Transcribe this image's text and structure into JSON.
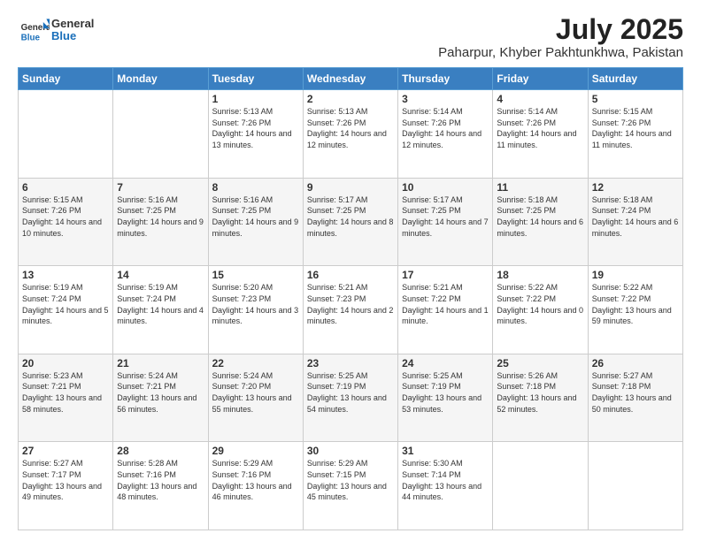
{
  "logo": {
    "general": "General",
    "blue": "Blue"
  },
  "title": "July 2025",
  "subtitle": "Paharpur, Khyber Pakhtunkhwa, Pakistan",
  "days": [
    "Sunday",
    "Monday",
    "Tuesday",
    "Wednesday",
    "Thursday",
    "Friday",
    "Saturday"
  ],
  "weeks": [
    [
      {
        "day": "",
        "info": ""
      },
      {
        "day": "",
        "info": ""
      },
      {
        "day": "1",
        "info": "Sunrise: 5:13 AM\nSunset: 7:26 PM\nDaylight: 14 hours and 13 minutes."
      },
      {
        "day": "2",
        "info": "Sunrise: 5:13 AM\nSunset: 7:26 PM\nDaylight: 14 hours and 12 minutes."
      },
      {
        "day": "3",
        "info": "Sunrise: 5:14 AM\nSunset: 7:26 PM\nDaylight: 14 hours and 12 minutes."
      },
      {
        "day": "4",
        "info": "Sunrise: 5:14 AM\nSunset: 7:26 PM\nDaylight: 14 hours and 11 minutes."
      },
      {
        "day": "5",
        "info": "Sunrise: 5:15 AM\nSunset: 7:26 PM\nDaylight: 14 hours and 11 minutes."
      }
    ],
    [
      {
        "day": "6",
        "info": "Sunrise: 5:15 AM\nSunset: 7:26 PM\nDaylight: 14 hours and 10 minutes."
      },
      {
        "day": "7",
        "info": "Sunrise: 5:16 AM\nSunset: 7:25 PM\nDaylight: 14 hours and 9 minutes."
      },
      {
        "day": "8",
        "info": "Sunrise: 5:16 AM\nSunset: 7:25 PM\nDaylight: 14 hours and 9 minutes."
      },
      {
        "day": "9",
        "info": "Sunrise: 5:17 AM\nSunset: 7:25 PM\nDaylight: 14 hours and 8 minutes."
      },
      {
        "day": "10",
        "info": "Sunrise: 5:17 AM\nSunset: 7:25 PM\nDaylight: 14 hours and 7 minutes."
      },
      {
        "day": "11",
        "info": "Sunrise: 5:18 AM\nSunset: 7:25 PM\nDaylight: 14 hours and 6 minutes."
      },
      {
        "day": "12",
        "info": "Sunrise: 5:18 AM\nSunset: 7:24 PM\nDaylight: 14 hours and 6 minutes."
      }
    ],
    [
      {
        "day": "13",
        "info": "Sunrise: 5:19 AM\nSunset: 7:24 PM\nDaylight: 14 hours and 5 minutes."
      },
      {
        "day": "14",
        "info": "Sunrise: 5:19 AM\nSunset: 7:24 PM\nDaylight: 14 hours and 4 minutes."
      },
      {
        "day": "15",
        "info": "Sunrise: 5:20 AM\nSunset: 7:23 PM\nDaylight: 14 hours and 3 minutes."
      },
      {
        "day": "16",
        "info": "Sunrise: 5:21 AM\nSunset: 7:23 PM\nDaylight: 14 hours and 2 minutes."
      },
      {
        "day": "17",
        "info": "Sunrise: 5:21 AM\nSunset: 7:22 PM\nDaylight: 14 hours and 1 minute."
      },
      {
        "day": "18",
        "info": "Sunrise: 5:22 AM\nSunset: 7:22 PM\nDaylight: 14 hours and 0 minutes."
      },
      {
        "day": "19",
        "info": "Sunrise: 5:22 AM\nSunset: 7:22 PM\nDaylight: 13 hours and 59 minutes."
      }
    ],
    [
      {
        "day": "20",
        "info": "Sunrise: 5:23 AM\nSunset: 7:21 PM\nDaylight: 13 hours and 58 minutes."
      },
      {
        "day": "21",
        "info": "Sunrise: 5:24 AM\nSunset: 7:21 PM\nDaylight: 13 hours and 56 minutes."
      },
      {
        "day": "22",
        "info": "Sunrise: 5:24 AM\nSunset: 7:20 PM\nDaylight: 13 hours and 55 minutes."
      },
      {
        "day": "23",
        "info": "Sunrise: 5:25 AM\nSunset: 7:19 PM\nDaylight: 13 hours and 54 minutes."
      },
      {
        "day": "24",
        "info": "Sunrise: 5:25 AM\nSunset: 7:19 PM\nDaylight: 13 hours and 53 minutes."
      },
      {
        "day": "25",
        "info": "Sunrise: 5:26 AM\nSunset: 7:18 PM\nDaylight: 13 hours and 52 minutes."
      },
      {
        "day": "26",
        "info": "Sunrise: 5:27 AM\nSunset: 7:18 PM\nDaylight: 13 hours and 50 minutes."
      }
    ],
    [
      {
        "day": "27",
        "info": "Sunrise: 5:27 AM\nSunset: 7:17 PM\nDaylight: 13 hours and 49 minutes."
      },
      {
        "day": "28",
        "info": "Sunrise: 5:28 AM\nSunset: 7:16 PM\nDaylight: 13 hours and 48 minutes."
      },
      {
        "day": "29",
        "info": "Sunrise: 5:29 AM\nSunset: 7:16 PM\nDaylight: 13 hours and 46 minutes."
      },
      {
        "day": "30",
        "info": "Sunrise: 5:29 AM\nSunset: 7:15 PM\nDaylight: 13 hours and 45 minutes."
      },
      {
        "day": "31",
        "info": "Sunrise: 5:30 AM\nSunset: 7:14 PM\nDaylight: 13 hours and 44 minutes."
      },
      {
        "day": "",
        "info": ""
      },
      {
        "day": "",
        "info": ""
      }
    ]
  ]
}
